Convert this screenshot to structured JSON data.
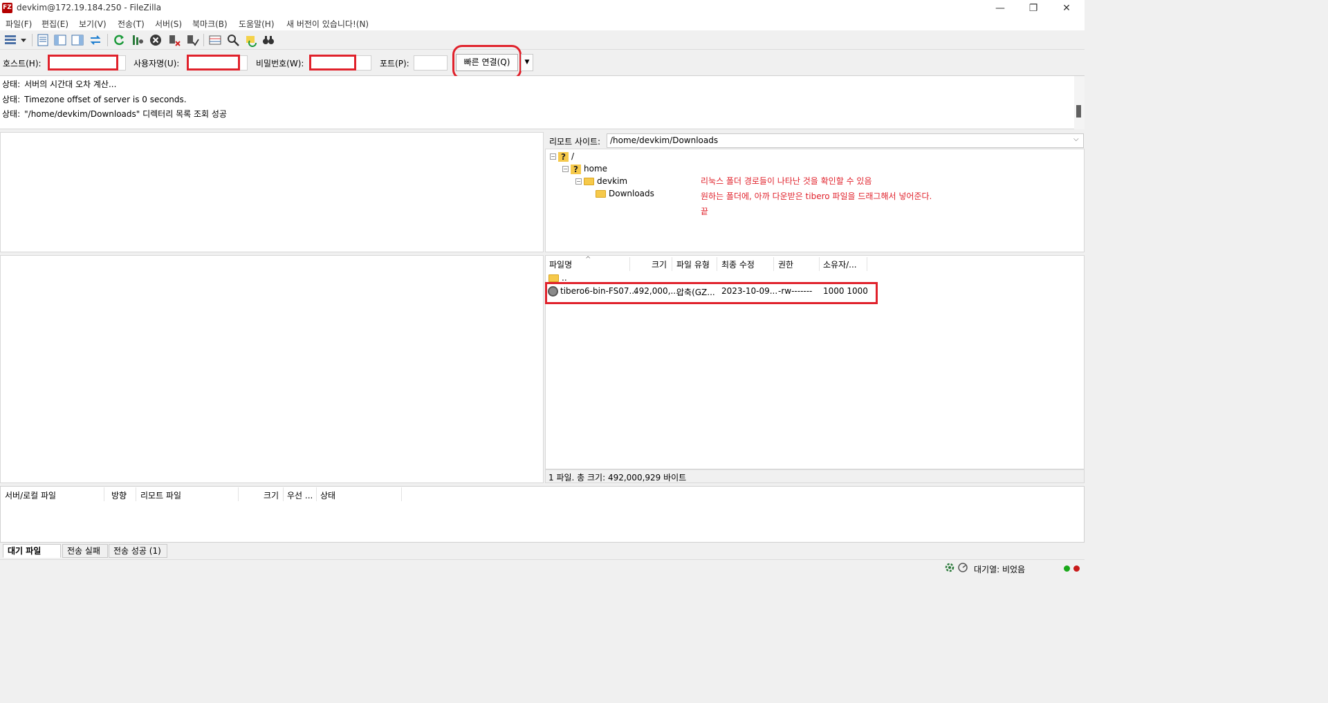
{
  "window": {
    "title": "devkim@172.19.184.250 - FileZilla",
    "app_icon_text": "FZ",
    "minimize": "—",
    "maximize": "❐",
    "close": "✕"
  },
  "menu": [
    "파일(F)",
    "편집(E)",
    "보기(V)",
    "전송(T)",
    "서버(S)",
    "북마크(B)",
    "도움말(H)",
    "새 버전이 있습니다!(N)"
  ],
  "toolbar": {
    "icons": [
      "site-manager-icon",
      "dropdown-arrow-icon",
      "message-log-icon",
      "local-tree-icon",
      "remote-tree-icon",
      "transfer-queue-icon",
      "refresh-icon",
      "process-queue-icon",
      "cancel-icon",
      "disconnect-icon",
      "reconnect-icon",
      "directory-compare-icon",
      "filter-icon",
      "sync-browse-icon",
      "search-icon"
    ]
  },
  "quickconnect": {
    "host_label": "호스트(H):",
    "user_label": "사용자명(U):",
    "pass_label": "비밀번호(W):",
    "port_label": "포트(P):",
    "button_label": "빠른 연결(Q)",
    "dropdown": "▼"
  },
  "log": [
    {
      "label": "상태:",
      "text": "서버의 시간대 오차 계산..."
    },
    {
      "label": "상태:",
      "text": "Timezone offset of server is 0 seconds."
    },
    {
      "label": "상태:",
      "text": "\"/home/devkim/Downloads\" 디렉터리 목록 조회 성공"
    }
  ],
  "remote": {
    "site_label": "리모트 사이트:",
    "path": "/home/devkim/Downloads",
    "tree": [
      {
        "label": "/",
        "expander": "⊟"
      },
      {
        "label": "home",
        "expander": "⊟"
      },
      {
        "label": "devkim",
        "expander": "⊟"
      },
      {
        "label": "Downloads",
        "expander": ""
      }
    ],
    "annotations": [
      "리눅스 폴더 경로들이 나타난 것을 확인할 수 있음",
      "원하는 폴더에, 아까 다운받은 tibero 파일을 드래그해서 넣어준다.",
      "끝"
    ],
    "columns": [
      "파일명",
      "크기",
      "파일 유형",
      "최종 수정",
      "권한",
      "소유자/..."
    ],
    "sort_indicator": "^",
    "parent_dir": "..",
    "files": [
      {
        "name": "tibero6-bin-FS07...",
        "size": "492,000,...",
        "type": "압축(GZ...",
        "modified": "2023-10-09...",
        "perms": "-rw-------",
        "owner": "1000 1000"
      }
    ],
    "status": "1 파일. 총 크기: 492,000,929 바이트"
  },
  "queue": {
    "columns": [
      "서버/로컬 파일",
      "방향",
      "리모트 파일",
      "크기",
      "우선 ...",
      "상태"
    ],
    "tabs": [
      "대기 파일",
      "전송 실패",
      "전송 성공 (1)"
    ]
  },
  "statusbar": {
    "queue_text": "대기열: 비었음"
  },
  "colors": {
    "highlight_red": "#e0212b",
    "folder_yellow": "#f6c94a",
    "led_green": "#1aa81a",
    "led_red": "#c81a1a"
  }
}
